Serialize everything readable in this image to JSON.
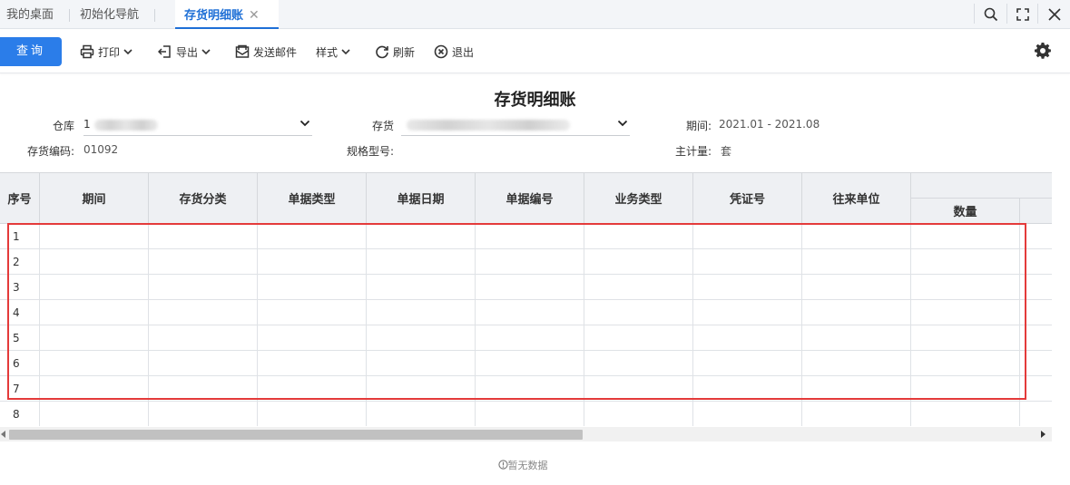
{
  "tabs": [
    {
      "label": "我的桌面"
    },
    {
      "label": "初始化导航"
    },
    {
      "label": "存货明细账",
      "close": "✕"
    }
  ],
  "toolbar": {
    "query": "查询",
    "print": "打印",
    "export": "导出",
    "send_email": "发送邮件",
    "style": "样式",
    "refresh": "刷新",
    "exit": "退出"
  },
  "report": {
    "title": "存货明细账",
    "warehouse_label": "仓库",
    "warehouse_value": "1",
    "inventory_label": "存货",
    "period_label": "期间:",
    "period_value": "2021.01 - 2021.08",
    "code_label": "存货编码:",
    "code_value": "01092",
    "spec_label": "规格型号:",
    "unit_label": "主计量:",
    "unit_value": "套"
  },
  "table": {
    "columns": [
      "序号",
      "期间",
      "存货分类",
      "单据类型",
      "单据日期",
      "单据编号",
      "业务类型",
      "凭证号",
      "往来单位"
    ],
    "group_sub": "数量",
    "rows": [
      "1",
      "2",
      "3",
      "4",
      "5",
      "6",
      "7",
      "8"
    ]
  },
  "empty_text": "暂无数据",
  "colors": {
    "accent": "#2b7de9",
    "highlight": "#e43a3a",
    "header_bg": "#eef0f3"
  }
}
